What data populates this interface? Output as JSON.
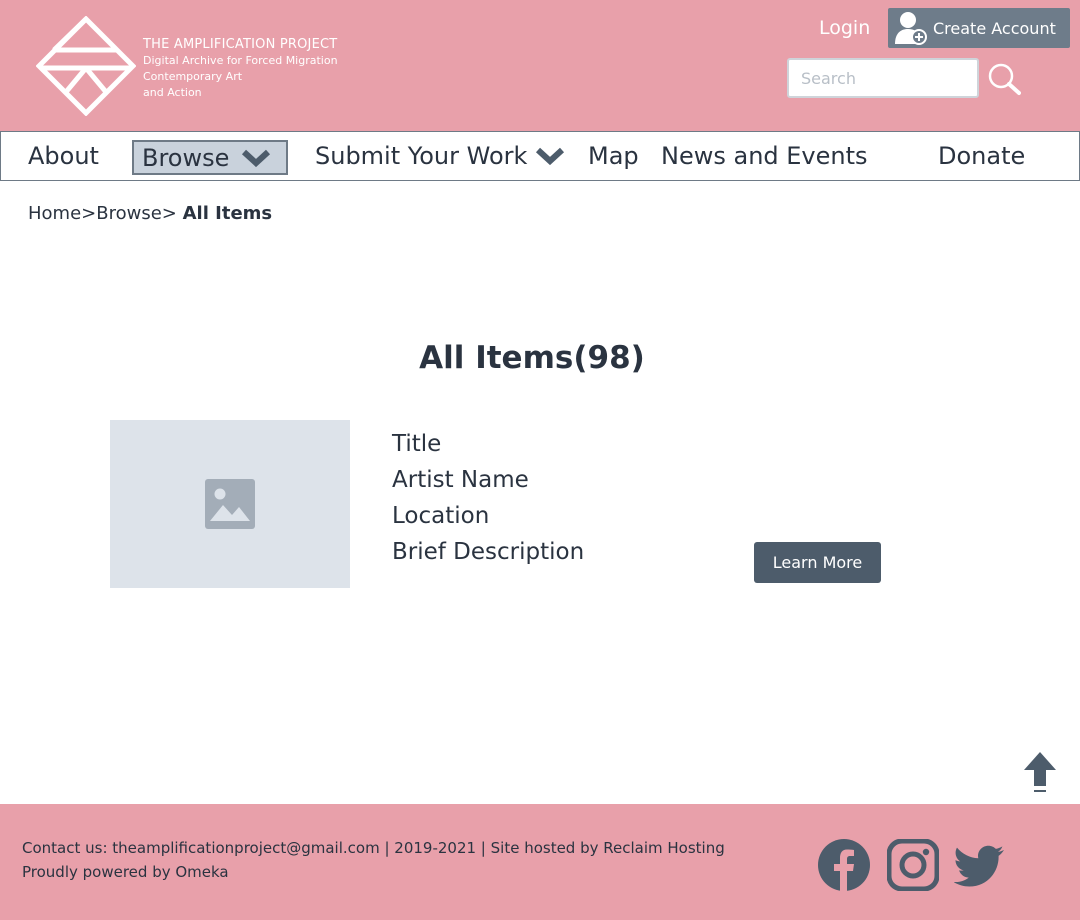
{
  "header": {
    "brand_title": "THE AMPLIFICATION PROJECT",
    "brand_line1": "Digital Archive for Forced Migration",
    "brand_line2": "Contemporary Art",
    "brand_line3": "and Action",
    "login_label": "Login",
    "create_account_label": "Create Account",
    "search_placeholder": "Search"
  },
  "nav": {
    "items": [
      {
        "label": "About"
      },
      {
        "label": "Browse"
      },
      {
        "label": "Submit Your Work"
      },
      {
        "label": "Map"
      },
      {
        "label": "News and Events"
      },
      {
        "label": "Donate"
      }
    ]
  },
  "breadcrumb": {
    "home": "Home",
    "sep1": ">",
    "browse": "Browse",
    "sep2": "> ",
    "current": "All Items"
  },
  "main": {
    "title": "All Items(98)",
    "item": {
      "title": "Title",
      "artist": "Artist Name",
      "location": "Location",
      "description": "Brief Description",
      "button_label": "Learn More"
    }
  },
  "footer": {
    "line1": "Contact us: theamplificationproject@gmail.com | 2019-2021 | Site hosted by Reclaim Hosting",
    "line2": "Proudly powered by Omeka",
    "social": [
      "facebook-icon",
      "instagram-icon",
      "twitter-icon"
    ]
  },
  "colors": {
    "brand_pink": "#e8a0aa",
    "dark_slate": "#4d5c6b",
    "placeholder_bg": "#dde3ea",
    "browse_highlight": "#c9d2dc"
  }
}
